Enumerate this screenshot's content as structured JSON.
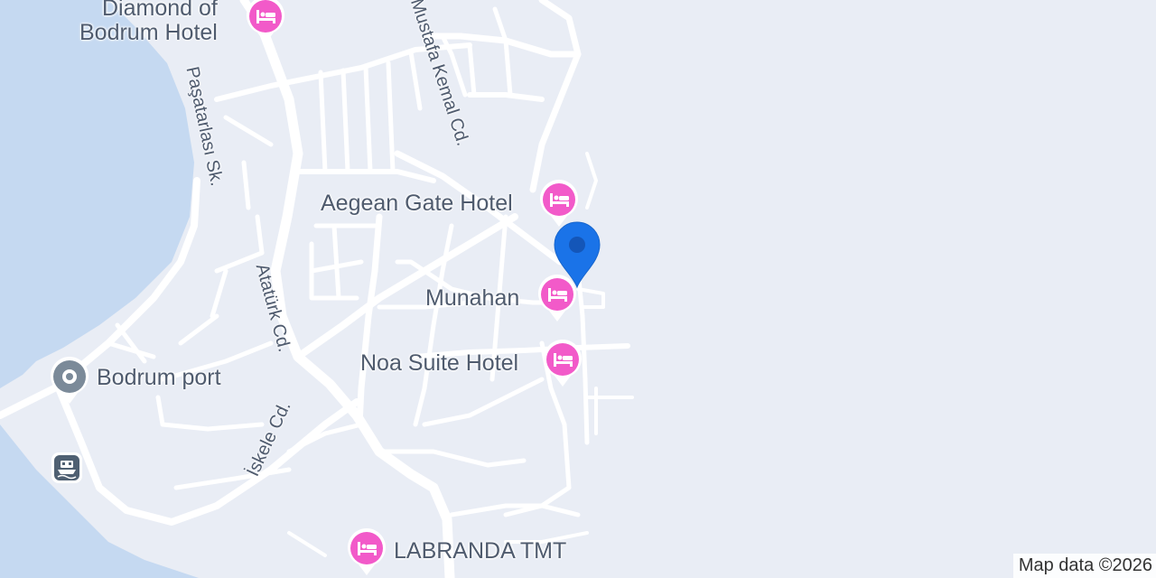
{
  "map": {
    "colors": {
      "land": "#e9edf5",
      "water": "#c5d9f1",
      "road": "#ffffff",
      "hotel_pin": "#f25ac9",
      "place_pin": "#7b8a99",
      "location_pin": "#1a73e8",
      "label_text": "#4f5b6e"
    },
    "places": [
      {
        "name": "Diamond of Bodrum Hotel",
        "line1": "Diamond of",
        "line2": "Bodrum Hotel",
        "icon": "hotel-icon"
      },
      {
        "name": "Aegean Gate Hotel",
        "icon": "hotel-icon"
      },
      {
        "name": "Munahan",
        "icon": "hotel-icon"
      },
      {
        "name": "Noa Suite Hotel",
        "icon": "hotel-icon"
      },
      {
        "name": "LABRANDA TMT",
        "icon": "hotel-icon"
      },
      {
        "name": "Bodrum port",
        "icon": "place-icon"
      }
    ],
    "streets": [
      {
        "name": "Mustafa Kemal Cd."
      },
      {
        "name": "Paşatarlası Sk."
      },
      {
        "name": "Atatürk Cd."
      },
      {
        "name": "İskele Cd."
      }
    ],
    "other_icons": [
      "ferry-icon",
      "location-pin-icon"
    ],
    "attribution": "Map data ©2026"
  }
}
